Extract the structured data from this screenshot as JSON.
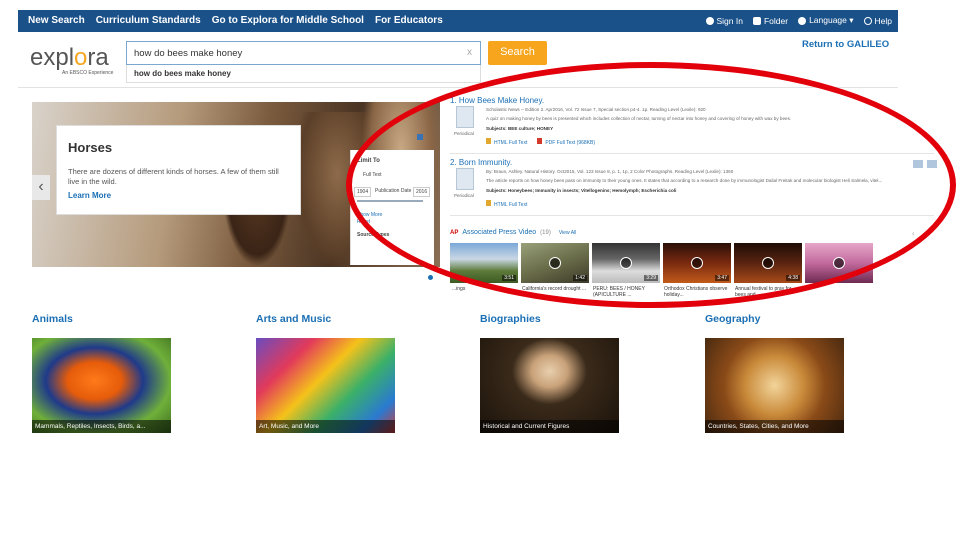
{
  "nav": {
    "left": [
      "New Search",
      "Curriculum Standards",
      "Go to Explora for Middle School",
      "For Educators"
    ],
    "right": [
      {
        "label": "Sign In",
        "icon": "user-icon"
      },
      {
        "label": "Folder",
        "icon": "folder-icon"
      },
      {
        "label": "Language ▾",
        "icon": "globe-icon"
      },
      {
        "label": "Help",
        "icon": "help-icon"
      }
    ]
  },
  "logo": {
    "brand": "explora",
    "tagline": "An EBSCO Experience"
  },
  "search": {
    "value": "how do bees make honey",
    "clear": "x",
    "suggestion": "how do bees make honey",
    "button": "Search"
  },
  "return_link": "Return to GALILEO",
  "hero": {
    "title": "Horses",
    "description": "There are dozens of different kinds of horses. A few of them still live in the wild.",
    "more": "Learn More",
    "prev": "‹"
  },
  "limiters": {
    "heading": "Limit To",
    "full_text": "Full Text",
    "from_year": "1904",
    "publication_date": "Publication Date",
    "to_year": "2016",
    "show_more": "Show More",
    "reset": "Reset",
    "source_types": "Source Types"
  },
  "results": [
    {
      "number": "1.",
      "title": "How Bees Make Honey.",
      "type": "Periodical",
      "source": "Scholastic News -- Edition 2. Apr2016, Vol. 72 Issue 7, Special section p4-4. 1p. Reading Level (Lexile): 920",
      "abstract": "A quiz on making honey by bees is presented which includes collection of nectar, turning of nectar into honey and covering of honey with wax by bees.",
      "subjects": "Subjects: BEE culture; HONEY",
      "links": [
        "HTML Full Text",
        "PDF Full Text (968KB)"
      ]
    },
    {
      "number": "2.",
      "title": "Born Immunity.",
      "type": "Periodical",
      "source": "By: Braun, Ashley. Natural History. Oct2015, Vol. 123 Issue 8, p. 1, 1p, 2 Color Photographs. Reading Level (Lexile): 1360",
      "abstract": "The article reports on how honey bees pass on immunity to their young ones. It states that according to a research done by immunologist Dalial Freitak and molecular biologist Heli Salmela, vitel...",
      "subjects": "Subjects: Honeybees; Immunity in insects; Vitellogenins; Hemolymph; Escherichia coli",
      "links": [
        "HTML Full Text"
      ]
    }
  ],
  "ap_video": {
    "logo": "AP",
    "title": "Associated Press Video",
    "count": "(19)",
    "view_all": "View All",
    "videos": [
      {
        "duration": "3:51",
        "caption": "...ings"
      },
      {
        "duration": "1:42",
        "caption": "California's record drought ..."
      },
      {
        "duration": "3:29",
        "caption": "PERU: BEES / HONEY (APICULTURE ..."
      },
      {
        "duration": "3:47",
        "caption": "Orthodox Christians observe holiday..."
      },
      {
        "duration": "4:38",
        "caption": "Annual festival to pray for bees and..."
      },
      {
        "duration": "",
        "caption": ""
      }
    ]
  },
  "categories": [
    {
      "title": "Animals",
      "caption": "Mammals, Reptiles, Insects, Birds, a..."
    },
    {
      "title": "Arts and Music",
      "caption": "Art, Music, and More"
    },
    {
      "title": "Biographies",
      "caption": "Historical and Current Figures"
    },
    {
      "title": "Geography",
      "caption": "Countries, States, Cities, and More"
    }
  ],
  "colors": {
    "nav": "#1b5189",
    "link": "#1b6fb5",
    "search_button": "#f7a51c",
    "annotation": "#e2000b"
  }
}
